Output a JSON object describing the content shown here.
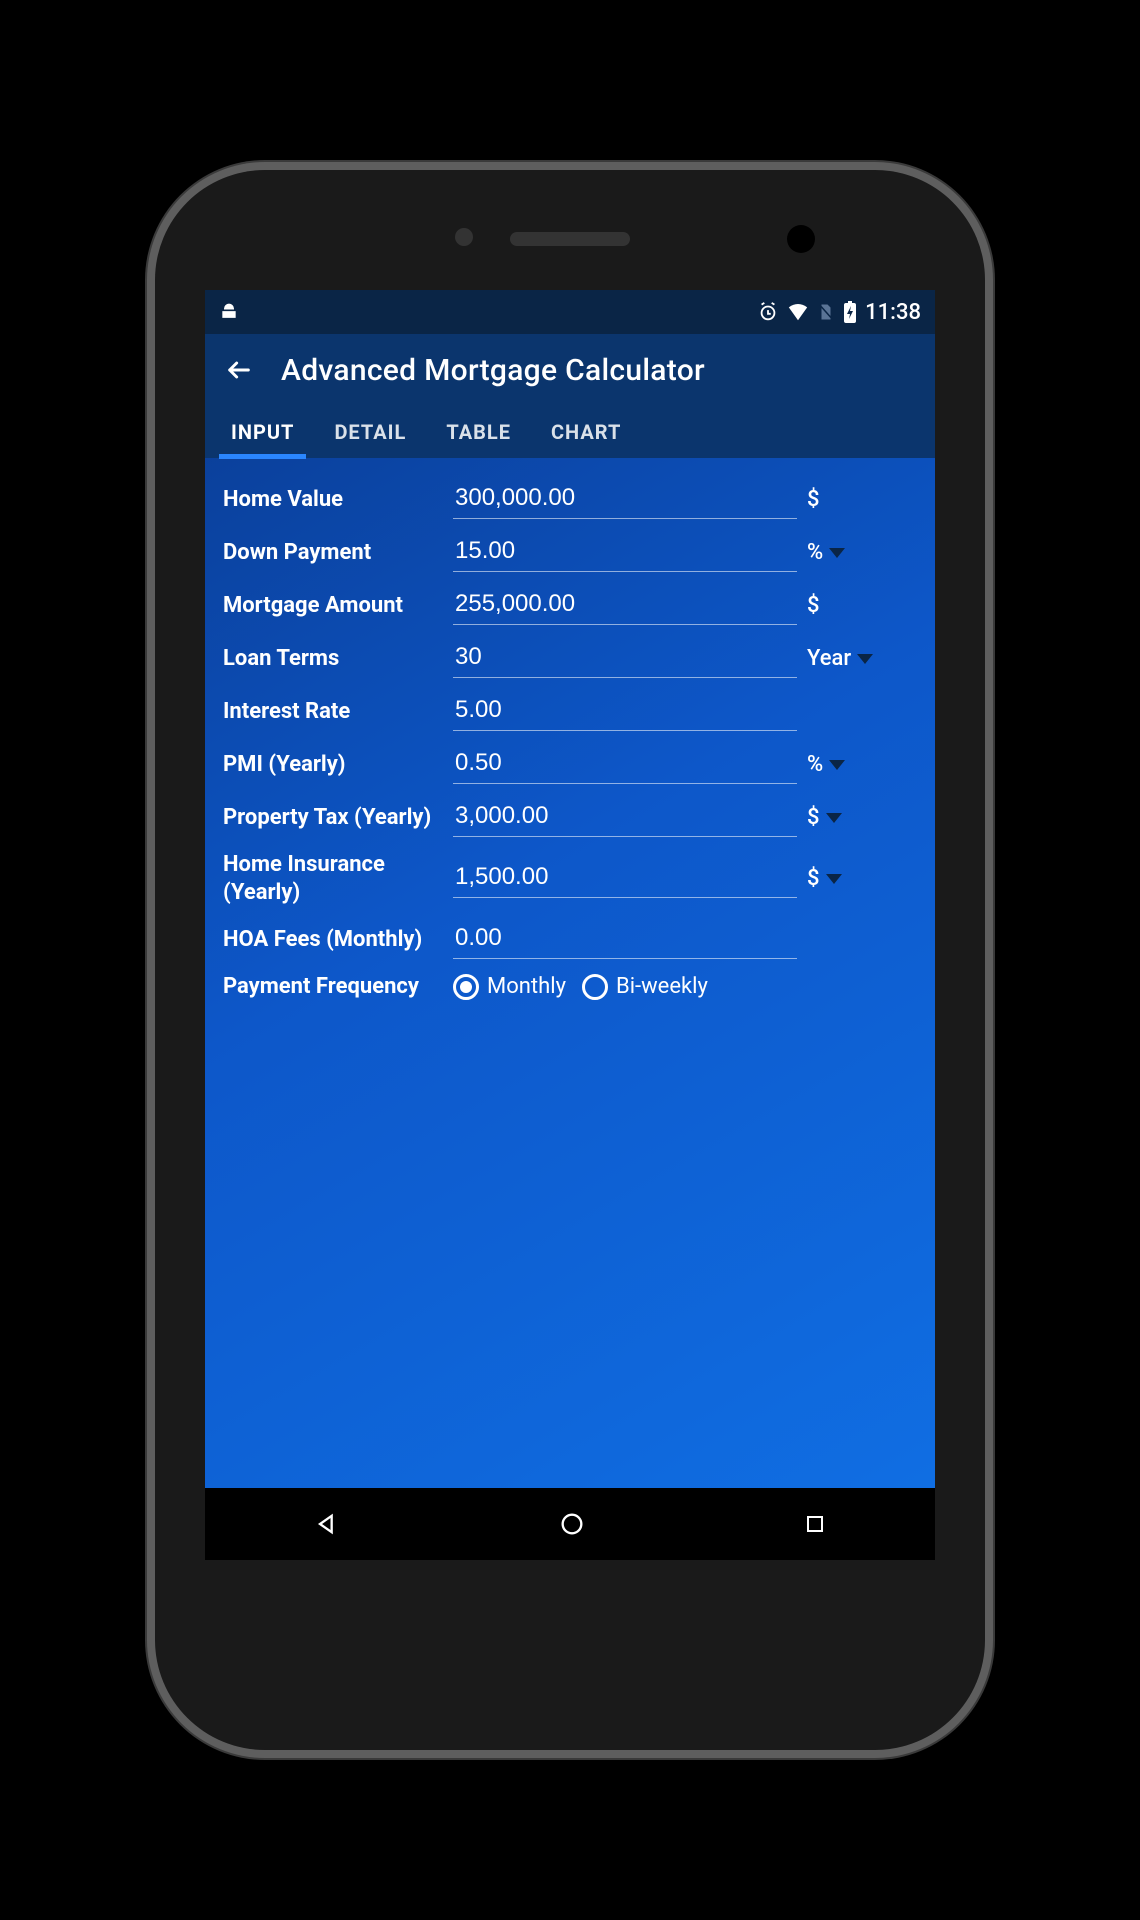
{
  "status": {
    "time": "11:38"
  },
  "appbar": {
    "title": "Advanced Mortgage Calculator"
  },
  "tabs": [
    {
      "label": "INPUT",
      "active": true
    },
    {
      "label": "DETAIL",
      "active": false
    },
    {
      "label": "TABLE",
      "active": false
    },
    {
      "label": "CHART",
      "active": false
    }
  ],
  "fields": {
    "home_value": {
      "label": "Home Value",
      "value": "300,000.00",
      "unit": "$",
      "has_dropdown": false
    },
    "down_payment": {
      "label": "Down Payment",
      "value": "15.00",
      "unit": "%",
      "has_dropdown": true
    },
    "mortgage_amount": {
      "label": "Mortgage Amount",
      "value": "255,000.00",
      "unit": "$",
      "has_dropdown": false
    },
    "loan_terms": {
      "label": "Loan Terms",
      "value": "30",
      "unit": "Year",
      "has_dropdown": true
    },
    "interest_rate": {
      "label": "Interest Rate",
      "value": "5.00",
      "unit": "",
      "has_dropdown": false
    },
    "pmi": {
      "label": "PMI (Yearly)",
      "value": "0.50",
      "unit": "%",
      "has_dropdown": true
    },
    "property_tax": {
      "label": "Property Tax (Yearly)",
      "value": "3,000.00",
      "unit": "$",
      "has_dropdown": true
    },
    "home_insurance": {
      "label": "Home Insurance (Yearly)",
      "value": "1,500.00",
      "unit": "$",
      "has_dropdown": true
    },
    "hoa": {
      "label": "HOA Fees (Monthly)",
      "value": "0.00",
      "unit": "",
      "has_dropdown": false
    }
  },
  "payment_frequency": {
    "label": "Payment Frequency",
    "options": [
      {
        "label": "Monthly",
        "selected": true
      },
      {
        "label": "Bi-weekly",
        "selected": false
      }
    ]
  }
}
